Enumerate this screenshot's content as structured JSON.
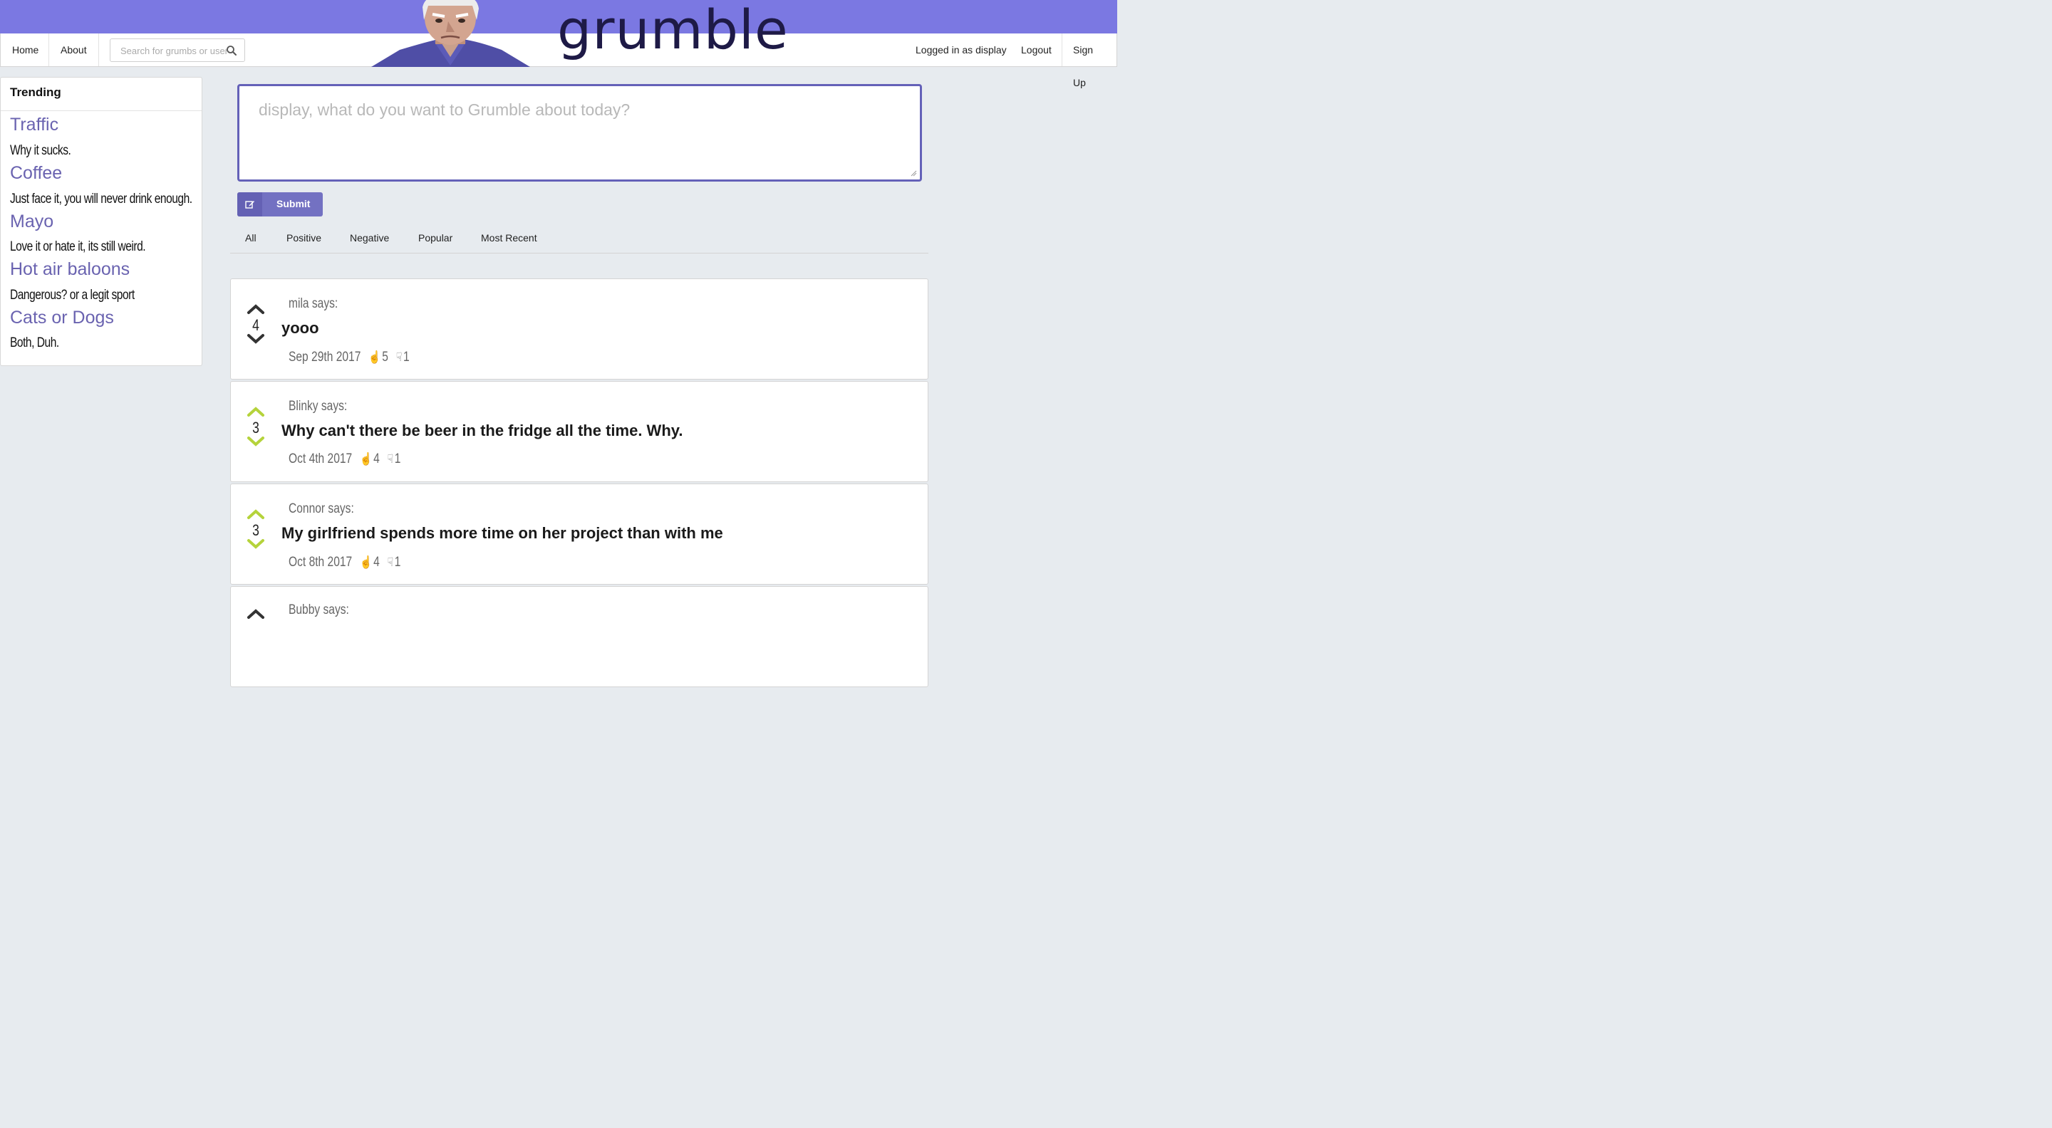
{
  "app": {
    "logo": "grumble"
  },
  "nav": {
    "home": "Home",
    "about": "About",
    "search_placeholder": "Search for grumbs or users",
    "logged_in": "Logged in as display",
    "logout": "Logout",
    "signup": "Sign Up"
  },
  "sidebar": {
    "heading": "Trending",
    "items": [
      {
        "title": "Traffic",
        "desc": "Why it sucks."
      },
      {
        "title": "Coffee",
        "desc": "Just face it, you will never drink enough."
      },
      {
        "title": "Mayo",
        "desc": "Love it or hate it, its still weird."
      },
      {
        "title": "Hot air baloons",
        "desc": "Dangerous? or a legit sport"
      },
      {
        "title": "Cats or Dogs",
        "desc": "Both, Duh."
      }
    ]
  },
  "composer": {
    "placeholder": "display, what do you want to Grumble about today?",
    "submit_label": "Submit"
  },
  "filters": [
    "All",
    "Positive",
    "Negative",
    "Popular",
    "Most Recent"
  ],
  "posts": [
    {
      "author": "mila says:",
      "score": "4",
      "content": "yooo",
      "date": "Sep 29th 2017",
      "up": "5",
      "down": "1"
    },
    {
      "author": "Blinky says:",
      "score": "3",
      "content": "Why can't there be beer in the fridge all the time. Why.",
      "date": "Oct 4th 2017",
      "up": "4",
      "down": "1"
    },
    {
      "author": "Connor says:",
      "score": "3",
      "content": "My girlfriend spends more time on her project than with me",
      "date": "Oct 8th 2017",
      "up": "4",
      "down": "1"
    },
    {
      "author": "Bubby says:"
    }
  ],
  "colors": {
    "brand_purple": "#7b78e2",
    "accent_link": "#6a63b0",
    "vote_dark": "#333333",
    "vote_green": "#b5d33b"
  }
}
